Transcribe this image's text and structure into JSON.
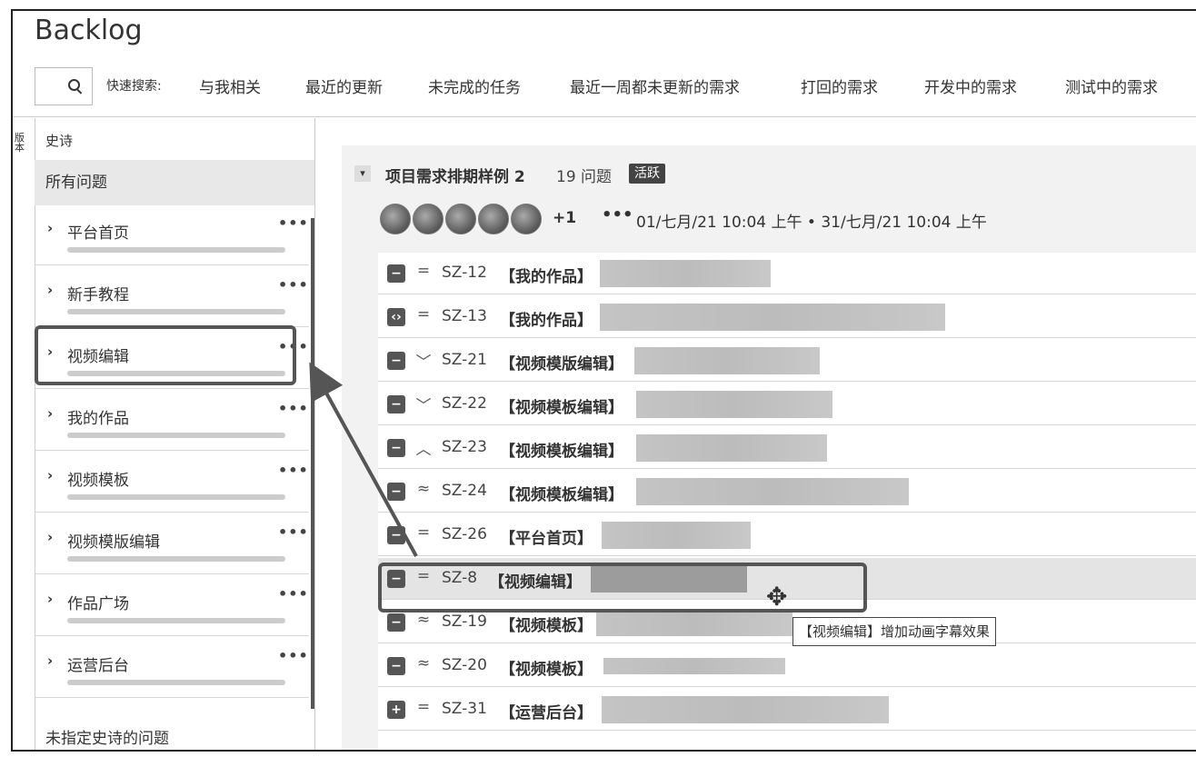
{
  "title": "Backlog",
  "search": {
    "icon": "search-icon",
    "quick_label": "快速搜索:"
  },
  "filters": [
    "与我相关",
    "最近的更新",
    "未完成的任务",
    "最近一周都未更新的需求",
    "打回的需求",
    "开发中的需求",
    "测试中的需求"
  ],
  "side_tab_label": "版本",
  "sidebar": {
    "heading": "史诗",
    "all_issues": "所有问题",
    "epics": [
      "平台首页",
      "新手教程",
      "视频编辑",
      "我的作品",
      "视频模板",
      "视频模版编辑",
      "作品广场",
      "运营后台"
    ],
    "more_glyph": "•••",
    "unassigned": "未指定史诗的问题"
  },
  "sprint": {
    "name": "项目需求排期样例 2",
    "count": "19 问题",
    "badge": "活跃",
    "avatar_more": "+1",
    "dates": "01/七月/21 10:04 上午 • 31/七月/21 10:04 上午"
  },
  "issues": [
    {
      "key": "SZ-12",
      "tag": "【我的作品】",
      "priority": "=",
      "type": "minus"
    },
    {
      "key": "SZ-13",
      "tag": "【我的作品】",
      "priority": "=",
      "type": "code"
    },
    {
      "key": "SZ-21",
      "tag": "【视频模版编辑】",
      "priority": "﹀",
      "type": "minus"
    },
    {
      "key": "SZ-22",
      "tag": "【视频模板编辑】",
      "priority": "﹀",
      "type": "minus"
    },
    {
      "key": "SZ-23",
      "tag": "【视频模板编辑】",
      "priority": "︿",
      "type": "minus"
    },
    {
      "key": "SZ-24",
      "tag": "【视频模板编辑】",
      "priority": "≈",
      "type": "minus"
    },
    {
      "key": "SZ-26",
      "tag": "【平台首页】",
      "priority": "=",
      "type": "minus"
    },
    {
      "key": "SZ-8",
      "tag": "【视频编辑】",
      "priority": "=",
      "type": "minus"
    },
    {
      "key": "SZ-19",
      "tag": "【视频模板】",
      "priority": "≈",
      "type": "minus"
    },
    {
      "key": "SZ-20",
      "tag": "【视频模板】",
      "priority": "≈",
      "type": "minus"
    },
    {
      "key": "SZ-31",
      "tag": "【运营后台】",
      "priority": "=",
      "type": "plus"
    }
  ],
  "tooltip": "【视频编辑】增加动画字幕效果",
  "colors": {
    "highlight": "#555555",
    "badge": "#444444"
  }
}
